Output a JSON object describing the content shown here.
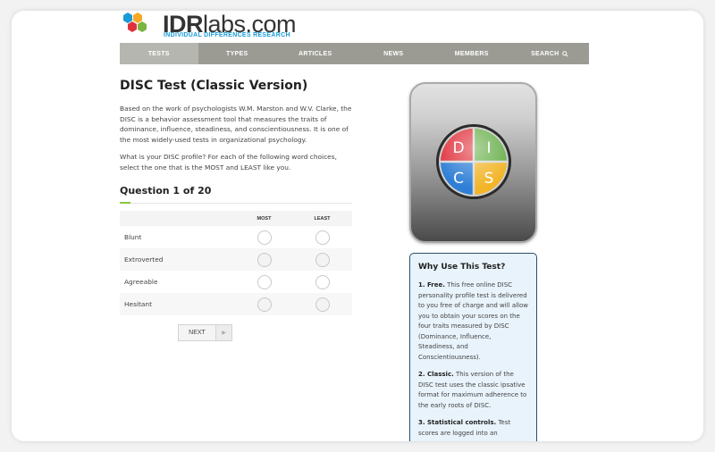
{
  "logo": {
    "wordmark_a": "IDR",
    "wordmark_b": "labs.com",
    "tagline": "INDIVIDUAL DIFFERENCES RESEARCH",
    "colors": [
      "#1a9ad6",
      "#f7a823",
      "#e0323c",
      "#7cb342"
    ]
  },
  "nav": {
    "items": [
      {
        "label": "TESTS"
      },
      {
        "label": "TYPES"
      },
      {
        "label": "ARTICLES"
      },
      {
        "label": "NEWS"
      },
      {
        "label": "MEMBERS"
      },
      {
        "label": "SEARCH"
      }
    ],
    "active_index": 0,
    "search_icon": "search-icon"
  },
  "page": {
    "title": "DISC Test (Classic Version)",
    "intro": "Based on the work of psychologists W.M. Marston and W.V. Clarke, the DISC is a behavior assessment tool that measures the traits of dominance, influence, steadiness, and conscientiousness. It is one of the most widely-used tests in organizational psychology.",
    "instructions": "What is your DISC profile? For each of the following word choices, select the one that is the MOST and LEAST like you."
  },
  "question": {
    "title": "Question 1 of 20",
    "col_most": "MOST",
    "col_least": "LEAST",
    "options": [
      {
        "label": "Blunt"
      },
      {
        "label": "Extroverted"
      },
      {
        "label": "Agreeable"
      },
      {
        "label": "Hesitant"
      }
    ],
    "next_label": "NEXT",
    "next_icon": "arrow-right-icon"
  },
  "disc_logo": {
    "letters": [
      "D",
      "I",
      "C",
      "S"
    ],
    "colors": {
      "D": "#e0323c",
      "I": "#6ab04c",
      "C": "#2f7fd6",
      "S": "#f2b52a"
    }
  },
  "why": {
    "title": "Why Use This Test?",
    "points": [
      {
        "lead": "1. Free.",
        "text": " This free online DISC personality profile test is delivered to you free of charge and will allow you to obtain your scores on the four traits measured by DISC (Dominance, Influence, Steadiness, and Conscientiousness)."
      },
      {
        "lead": "2. Classic.",
        "text": " This version of the DISC test uses the classic ipsative format for maximum adherence to the early roots of DISC."
      },
      {
        "lead": "3. Statistical controls.",
        "text": " Test scores are logged into an"
      }
    ]
  }
}
